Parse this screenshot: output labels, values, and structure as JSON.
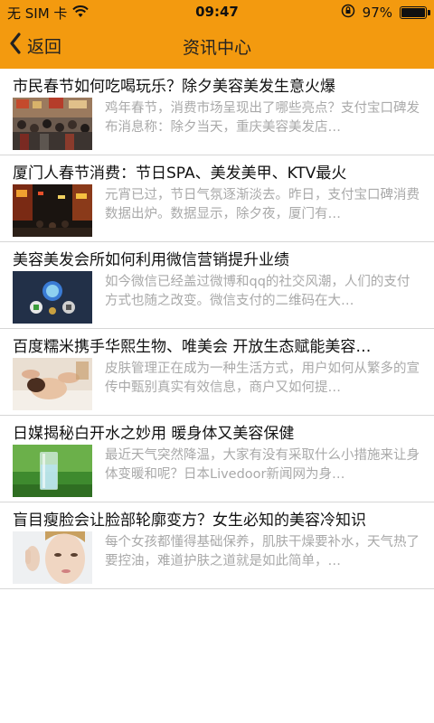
{
  "status_bar": {
    "carrier": "无 SIM 卡",
    "time": "09:47",
    "battery_percent": "97%",
    "battery_level": 0.97,
    "icons": [
      "wifi-icon",
      "orientation-lock-icon",
      "battery-icon"
    ]
  },
  "nav": {
    "back_label": "返回",
    "title": "资讯中心",
    "accent_color": "#f39a0f"
  },
  "news": [
    {
      "title": "市民春节如何吃喝玩乐？除夕美容美发生意火爆",
      "summary": "鸡年春节，消费市场呈现出了哪些亮点？支付宝口碑发布消息称：除夕当天，重庆美容美发店…",
      "thumb": "crowd-street-photo"
    },
    {
      "title": "厦门人春节消费：节日SPA、美发美甲、KTV最火",
      "summary": "元宵已过，节日气氛逐渐淡去。昨日，支付宝口碑消费数据出炉。数据显示，除夕夜，厦门有…",
      "thumb": "night-street-photo"
    },
    {
      "title": "美容美发会所如何利用微信营销提升业绩",
      "summary": "如今微信已经盖过微博和qq的社交风潮，人们的支付方式也随之改变。微信支付的二维码在大…",
      "thumb": "app-icons-photo"
    },
    {
      "title": "百度糯米携手华熙生物、唯美会 开放生态赋能美容…",
      "summary": "皮肤管理正在成为一种生活方式，用户如何从繁多的宣传中甄别真实有效信息，商户又如何提…",
      "thumb": "facial-massage-photo"
    },
    {
      "title": "日媒揭秘白开水之妙用 暖身体又美容保健",
      "summary": "最近天气突然降温，大家有没有采取什么小措施来让身体变暖和呢？日本Livedoor新闻网为身…",
      "thumb": "water-glass-photo"
    },
    {
      "title": "盲目瘦脸会让脸部轮廓变方？女生必知的美容冷知识",
      "summary": "每个女孩都懂得基础保养，肌肤干燥要补水，天气热了要控油，难道护肤之道就是如此简单，…",
      "thumb": "woman-face-photo"
    }
  ]
}
